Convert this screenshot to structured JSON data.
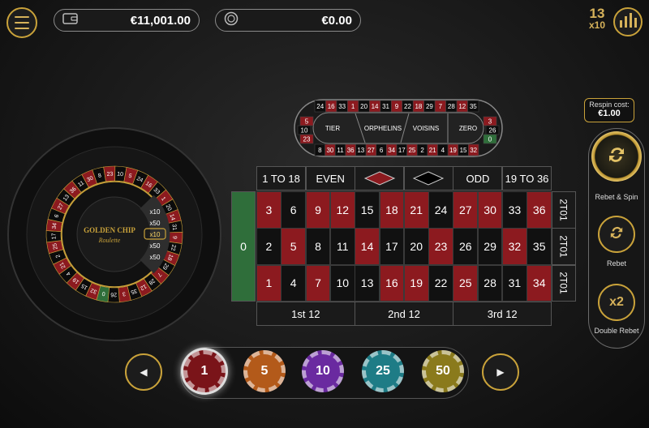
{
  "header": {
    "balance": "€11,001.00",
    "bet": "€0.00",
    "round_count": "13",
    "multiplier": "x10"
  },
  "racetrack": {
    "top_row": [
      "24",
      "16",
      "33",
      "1",
      "20",
      "14",
      "31",
      "9",
      "22",
      "18",
      "29",
      "7",
      "28",
      "12",
      "35"
    ],
    "bottom_row": [
      "8",
      "30",
      "11",
      "36",
      "13",
      "27",
      "6",
      "34",
      "17",
      "25",
      "2",
      "21",
      "4",
      "19",
      "15",
      "32"
    ],
    "left_side": [
      "5",
      "10",
      "23"
    ],
    "right_side": [
      "3",
      "26",
      "0"
    ],
    "sections": [
      "TIER",
      "ORPHELINS",
      "VOISINS",
      "ZERO"
    ]
  },
  "wheel": {
    "brand": "GOLDEN CHIP",
    "sub": "Roulette",
    "multipliers": [
      "x10",
      "x50",
      "x10",
      "x50",
      "x50"
    ],
    "numbers": [
      "0",
      "32",
      "15",
      "19",
      "4",
      "21",
      "2",
      "25",
      "17",
      "34",
      "6",
      "27",
      "13",
      "36",
      "11",
      "30",
      "8",
      "23",
      "10",
      "5",
      "24",
      "16",
      "33",
      "1",
      "20",
      "14",
      "31",
      "9",
      "22",
      "18",
      "29",
      "7",
      "28",
      "12",
      "35",
      "3",
      "26"
    ],
    "colors": [
      "green",
      "red",
      "black",
      "red",
      "black",
      "red",
      "black",
      "red",
      "black",
      "red",
      "black",
      "red",
      "black",
      "red",
      "black",
      "red",
      "black",
      "red",
      "black",
      "red",
      "black",
      "red",
      "black",
      "red",
      "black",
      "red",
      "black",
      "red",
      "black",
      "red",
      "black",
      "red",
      "black",
      "red",
      "black",
      "red",
      "black"
    ]
  },
  "table": {
    "zero": "0",
    "rows": [
      [
        "3",
        "6",
        "9",
        "12",
        "15",
        "18",
        "21",
        "24",
        "27",
        "30",
        "33",
        "36"
      ],
      [
        "2",
        "5",
        "8",
        "11",
        "14",
        "17",
        "20",
        "23",
        "26",
        "29",
        "32",
        "35"
      ],
      [
        "1",
        "4",
        "7",
        "10",
        "13",
        "16",
        "19",
        "22",
        "25",
        "28",
        "31",
        "34"
      ]
    ],
    "red_numbers": [
      "1",
      "3",
      "5",
      "7",
      "9",
      "12",
      "14",
      "16",
      "18",
      "19",
      "21",
      "23",
      "25",
      "27",
      "30",
      "32",
      "34",
      "36"
    ],
    "column_bets": [
      "2T01",
      "2T01",
      "2T01"
    ],
    "outside_bets": [
      "1 TO 18",
      "EVEN",
      "",
      "",
      "ODD",
      "19 TO 36"
    ],
    "dozens": [
      "1st 12",
      "2nd 12",
      "3rd 12"
    ]
  },
  "right_panel": {
    "respin_label": "Respin cost:",
    "respin_value": "€1.00",
    "rebet_spin": "Rebet & Spin",
    "rebet": "Rebet",
    "double_symbol": "x2",
    "double_rebet": "Double Rebet"
  },
  "chips": {
    "values": [
      "1",
      "5",
      "10",
      "25",
      "50"
    ],
    "colors": [
      "#7a1419",
      "#b35a1a",
      "#6a2aa0",
      "#1e7c86",
      "#8a7a1c"
    ],
    "selected": "1"
  },
  "colors": {
    "gold": "#c9a23a",
    "red": "#8c1a1f",
    "black": "#111111",
    "green": "#2f6e3a"
  }
}
